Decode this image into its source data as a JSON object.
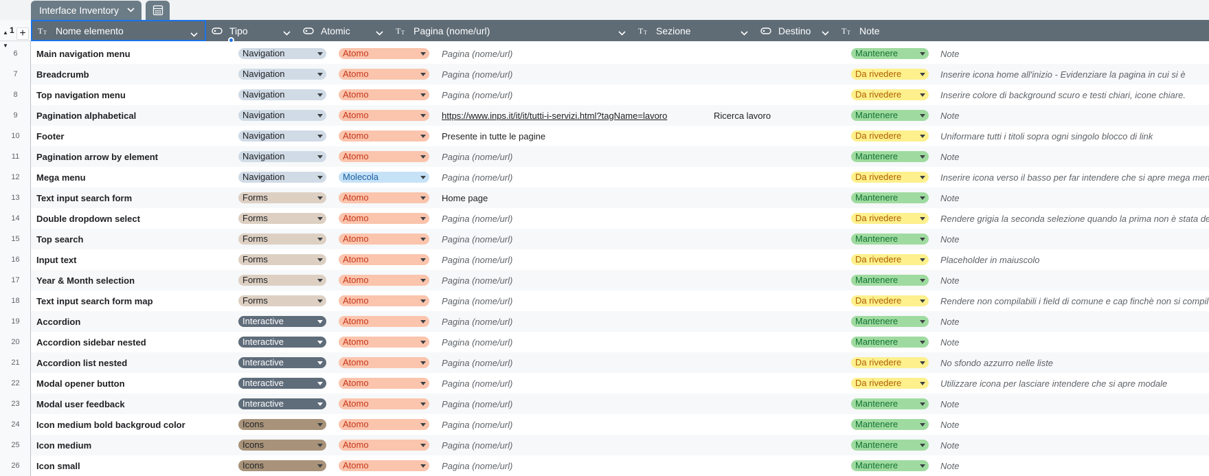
{
  "table_tab": {
    "title": "Interface Inventory"
  },
  "gutter": {
    "header_number": "1"
  },
  "columns": [
    {
      "label": "Nome elemento",
      "type_icon": "text-type-icon"
    },
    {
      "label": "Tipo",
      "type_icon": "single-select-icon"
    },
    {
      "label": "Atomic",
      "type_icon": "single-select-icon"
    },
    {
      "label": "Pagina (nome/url)",
      "type_icon": "text-type-icon"
    },
    {
      "label": "Sezione",
      "type_icon": "text-type-icon"
    },
    {
      "label": "Destino",
      "type_icon": "single-select-icon"
    },
    {
      "label": "Note",
      "type_icon": "text-type-icon"
    }
  ],
  "chip_colors": {
    "Navigation": {
      "bg": "#d0dbe6",
      "fg": "#202124",
      "arrow": "#3c4043"
    },
    "Forms": {
      "bg": "#ddd0c3",
      "fg": "#202124",
      "arrow": "#3c4043"
    },
    "Interactive": {
      "bg": "#5f6c7a",
      "fg": "#ffffff",
      "arrow": "#ffffff"
    },
    "Icons": {
      "bg": "#a8937a",
      "fg": "#202124",
      "arrow": "#3c4043"
    },
    "Atomo": {
      "bg": "#fbc4ad",
      "fg": "#c5381b",
      "arrow": "#3c4043"
    },
    "Molecola": {
      "bg": "#c6e2f7",
      "fg": "#1a5fa0",
      "arrow": "#3c4043"
    },
    "Mantenere": {
      "bg": "#9fdba0",
      "fg": "#137333",
      "arrow": "#3c4043"
    },
    "Da rivedere": {
      "bg": "#fdf08d",
      "fg": "#b06000",
      "arrow": "#3c4043"
    }
  },
  "rows": [
    {
      "num": "6",
      "name": "Main navigation menu",
      "tipo": "Navigation",
      "atomic": "Atomo",
      "pagina": "Pagina (nome/url)",
      "pagina_kind": "placeholder",
      "sezione": "",
      "destino": "Mantenere",
      "note": "Note"
    },
    {
      "num": "7",
      "name": "Breadcrumb",
      "tipo": "Navigation",
      "atomic": "Atomo",
      "pagina": "Pagina (nome/url)",
      "pagina_kind": "placeholder",
      "sezione": "",
      "destino": "Da rivedere",
      "note": "Inserire icona home all'inizio - Evidenziare la pagina in cui si è"
    },
    {
      "num": "8",
      "name": "Top navigation menu",
      "tipo": "Navigation",
      "atomic": "Atomo",
      "pagina": "Pagina (nome/url)",
      "pagina_kind": "placeholder",
      "sezione": "",
      "destino": "Da rivedere",
      "note": "Inserire colore di background scuro e testi chiari, icone chiare."
    },
    {
      "num": "9",
      "name": "Pagination alphabetical",
      "tipo": "Navigation",
      "atomic": "Atomo",
      "pagina": "https://www.inps.it/it/it/tutti-i-servizi.html?tagName=lavoro",
      "pagina_kind": "link",
      "sezione": "Ricerca lavoro",
      "destino": "Mantenere",
      "note": "Note"
    },
    {
      "num": "10",
      "name": "Footer",
      "tipo": "Navigation",
      "atomic": "Atomo",
      "pagina": "Presente in tutte le pagine",
      "pagina_kind": "text",
      "sezione": "",
      "destino": "Da rivedere",
      "note": "Uniformare tutti i titoli sopra ogni singolo blocco di link"
    },
    {
      "num": "11",
      "name": "Pagination arrow by element",
      "tipo": "Navigation",
      "atomic": "Atomo",
      "pagina": "Pagina (nome/url)",
      "pagina_kind": "placeholder",
      "sezione": "",
      "destino": "Mantenere",
      "note": "Note"
    },
    {
      "num": "12",
      "name": "Mega menu",
      "tipo": "Navigation",
      "atomic": "Molecola",
      "pagina": "Pagina (nome/url)",
      "pagina_kind": "placeholder",
      "sezione": "",
      "destino": "Da rivedere",
      "note": "Inserire icona verso il basso per far intendere che si apre mega men"
    },
    {
      "num": "13",
      "name": "Text input search form",
      "tipo": "Forms",
      "atomic": "Atomo",
      "pagina": "Home page",
      "pagina_kind": "text",
      "sezione": "",
      "destino": "Mantenere",
      "note": "Note"
    },
    {
      "num": "14",
      "name": "Double dropdown select",
      "tipo": "Forms",
      "atomic": "Atomo",
      "pagina": "Pagina (nome/url)",
      "pagina_kind": "placeholder",
      "sezione": "",
      "destino": "Da rivedere",
      "note": "Rendere grigia la seconda selezione quando la prima non è stata de"
    },
    {
      "num": "15",
      "name": "Top search",
      "tipo": "Forms",
      "atomic": "Atomo",
      "pagina": "Pagina (nome/url)",
      "pagina_kind": "placeholder",
      "sezione": "",
      "destino": "Mantenere",
      "note": "Note"
    },
    {
      "num": "16",
      "name": "Input text",
      "tipo": "Forms",
      "atomic": "Atomo",
      "pagina": "Pagina (nome/url)",
      "pagina_kind": "placeholder",
      "sezione": "",
      "destino": "Da rivedere",
      "note": "Placeholder in maiuscolo"
    },
    {
      "num": "17",
      "name": "Year & Month selection",
      "tipo": "Forms",
      "atomic": "Atomo",
      "pagina": "Pagina (nome/url)",
      "pagina_kind": "placeholder",
      "sezione": "",
      "destino": "Mantenere",
      "note": "Note"
    },
    {
      "num": "18",
      "name": "Text input search form map",
      "tipo": "Forms",
      "atomic": "Atomo",
      "pagina": "Pagina (nome/url)",
      "pagina_kind": "placeholder",
      "sezione": "",
      "destino": "Da rivedere",
      "note": "Rendere non compilabili i field di comune e cap finchè non si compil"
    },
    {
      "num": "19",
      "name": "Accordion",
      "tipo": "Interactive",
      "atomic": "Atomo",
      "pagina": "Pagina (nome/url)",
      "pagina_kind": "placeholder",
      "sezione": "",
      "destino": "Mantenere",
      "note": "Note"
    },
    {
      "num": "20",
      "name": "Accordion sidebar nested",
      "tipo": "Interactive",
      "atomic": "Atomo",
      "pagina": "Pagina (nome/url)",
      "pagina_kind": "placeholder",
      "sezione": "",
      "destino": "Mantenere",
      "note": "Note"
    },
    {
      "num": "21",
      "name": "Accordion list nested",
      "tipo": "Interactive",
      "atomic": "Atomo",
      "pagina": "Pagina (nome/url)",
      "pagina_kind": "placeholder",
      "sezione": "",
      "destino": "Da rivedere",
      "note": "No sfondo azzurro nelle liste"
    },
    {
      "num": "22",
      "name": "Modal opener button",
      "tipo": "Interactive",
      "atomic": "Atomo",
      "pagina": "Pagina (nome/url)",
      "pagina_kind": "placeholder",
      "sezione": "",
      "destino": "Da rivedere",
      "note": "Utilizzare icona per lasciare intendere che si apre modale"
    },
    {
      "num": "23",
      "name": "Modal user feedback",
      "tipo": "Interactive",
      "atomic": "Atomo",
      "pagina": "Pagina (nome/url)",
      "pagina_kind": "placeholder",
      "sezione": "",
      "destino": "Mantenere",
      "note": "Note"
    },
    {
      "num": "24",
      "name": "Icon medium bold backgroud color",
      "tipo": "Icons",
      "atomic": "Atomo",
      "pagina": "Pagina (nome/url)",
      "pagina_kind": "placeholder",
      "sezione": "",
      "destino": "Mantenere",
      "note": "Note"
    },
    {
      "num": "25",
      "name": "Icon medium",
      "tipo": "Icons",
      "atomic": "Atomo",
      "pagina": "Pagina (nome/url)",
      "pagina_kind": "placeholder",
      "sezione": "",
      "destino": "Mantenere",
      "note": "Note"
    },
    {
      "num": "26",
      "name": "Icon small",
      "tipo": "Icons",
      "atomic": "Atomo",
      "pagina": "Pagina (nome/url)",
      "pagina_kind": "placeholder",
      "sezione": "",
      "destino": "Mantenere",
      "note": "Note"
    }
  ]
}
